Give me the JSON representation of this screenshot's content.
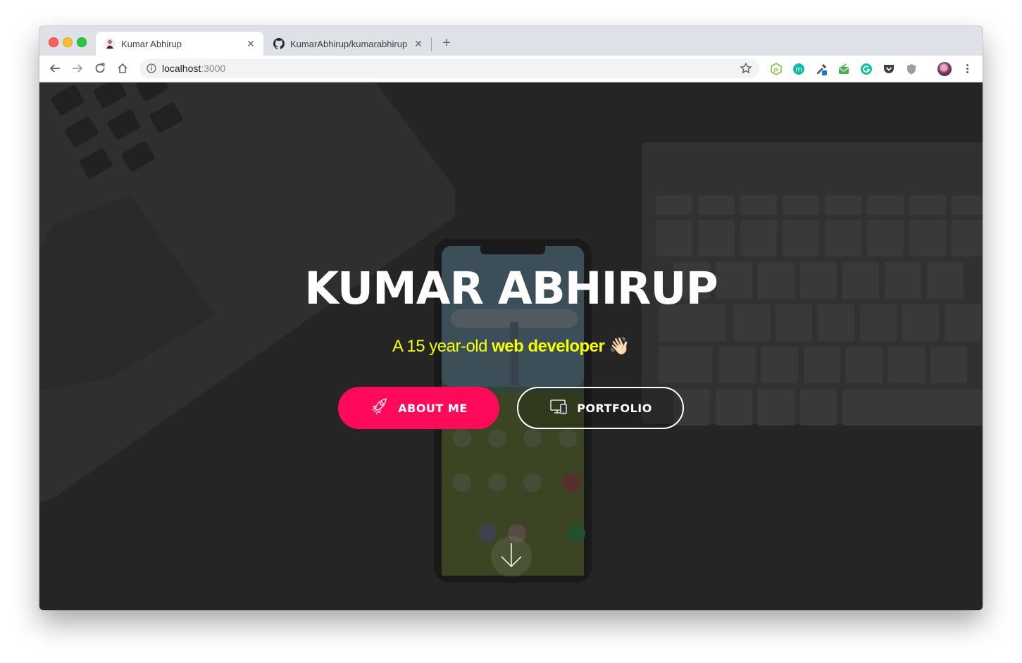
{
  "browser": {
    "tabs": [
      {
        "title": "Kumar Abhirup",
        "active": true,
        "favicon": "avatar-favicon-icon"
      },
      {
        "title": "KumarAbhirup/kumarabhirup",
        "active": false,
        "favicon": "github-icon"
      }
    ],
    "close_glyph": "✕",
    "new_tab_glyph": "+",
    "url_host": "localhost",
    "url_port": ":3000",
    "extensions": [
      "nodejs-icon",
      "m-extension-icon",
      "eyedropper-icon",
      "mail-check-icon",
      "grammarly-icon",
      "pocket-icon",
      "shield-icon"
    ]
  },
  "hero": {
    "title": "KUMAR ABHIRUP",
    "subtitle_prefix": "A 15 year-old ",
    "subtitle_bold": "web developer",
    "subtitle_emoji": "👋🏻",
    "about_label": "ABOUT ME",
    "portfolio_label": "PORTFOLIO"
  },
  "colors": {
    "accent": "#ff0a5a",
    "subtitle": "#f6ff00",
    "hero_overlay": "#2b2b2c"
  }
}
